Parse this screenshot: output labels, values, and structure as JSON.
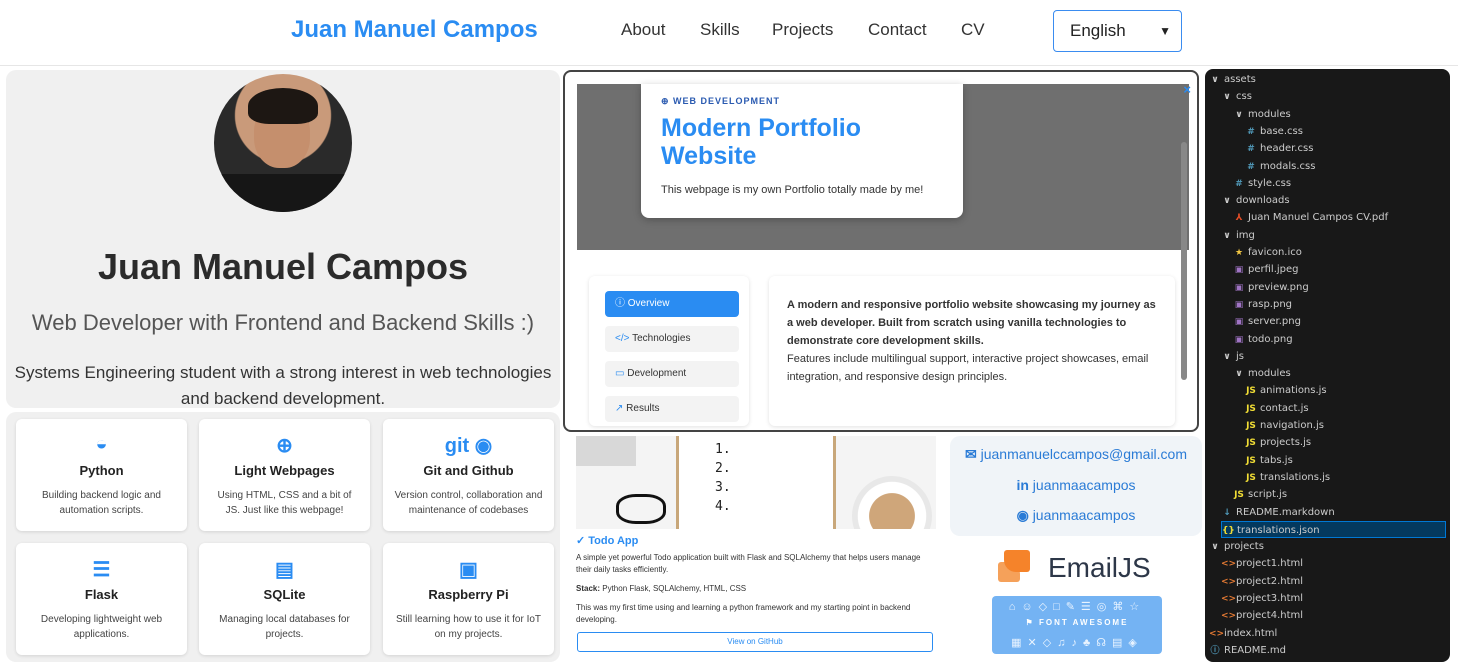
{
  "header": {
    "brand": "Juan Manuel Campos",
    "nav": [
      "About",
      "Skills",
      "Projects",
      "Contact",
      "CV"
    ],
    "language": "English"
  },
  "hero": {
    "name": "Juan Manuel Campos",
    "role": "Web Developer with Frontend and Backend Skills :)",
    "bio": "Systems Engineering student with a strong interest in web technologies and backend development."
  },
  "skills": [
    {
      "icon": "python-icon",
      "title": "Python",
      "desc": "Building backend logic and automation scripts."
    },
    {
      "icon": "globe-icon",
      "title": "Light Webpages",
      "desc": "Using HTML, CSS and a bit of JS. Just like this webpage!"
    },
    {
      "icon": "git-github-icon",
      "title": "Git and Github",
      "desc": "Version control, collaboration and maintenance of codebases"
    },
    {
      "icon": "server-icon",
      "title": "Flask",
      "desc": "Developing lightweight web applications."
    },
    {
      "icon": "database-icon",
      "title": "SQLite",
      "desc": "Managing local databases for projects."
    },
    {
      "icon": "chip-icon",
      "title": "Raspberry Pi",
      "desc": "Still learning how to use it for IoT on my projects."
    }
  ],
  "skill_git_text": "git",
  "modal": {
    "kicker": "WEB DEVELOPMENT",
    "title": "Modern Portfolio Website",
    "subtitle": "This webpage is my own Portfolio totally made by me!",
    "close": "×",
    "tabs": [
      "Overview",
      "Technologies",
      "Development",
      "Results"
    ],
    "tab_icons": [
      "ⓘ",
      "</>",
      "▭",
      "↗"
    ],
    "body_bold": "A modern and responsive portfolio website showcasing my journey as a web developer. Built from scratch using vanilla technologies to demonstrate core development skills.",
    "body_text": "Features include multilingual support, interactive project showcases, email integration, and responsive design principles."
  },
  "todo": {
    "list": [
      "1.",
      "2.",
      "3.",
      "4."
    ],
    "title": "Todo App",
    "desc": "A simple yet powerful Todo application built with Flask and SQLAlchemy that helps users manage their daily tasks efficiently.",
    "stack_label": "Stack:",
    "stack": "Python Flask, SQLAlchemy, HTML, CSS",
    "note": "This was my first time using and learning a python framework and my starting point in backend developing.",
    "button": "View on GitHub"
  },
  "contact": {
    "email": "juanmanuelccampos@gmail.com",
    "linkedin": "juanmaacampos",
    "github": "juanmaacampos"
  },
  "emailjs": "EmailJS",
  "fontawesome": "FONT AWESOME",
  "explorer": [
    {
      "label": "assets",
      "indent": 0,
      "type": "folder"
    },
    {
      "label": "css",
      "indent": 1,
      "type": "folder"
    },
    {
      "label": "modules",
      "indent": 2,
      "type": "folder"
    },
    {
      "label": "base.css",
      "indent": 3,
      "type": "css"
    },
    {
      "label": "header.css",
      "indent": 3,
      "type": "css"
    },
    {
      "label": "modals.css",
      "indent": 3,
      "type": "css"
    },
    {
      "label": "style.css",
      "indent": 2,
      "type": "css"
    },
    {
      "label": "downloads",
      "indent": 1,
      "type": "folder"
    },
    {
      "label": "Juan Manuel Campos CV.pdf",
      "indent": 2,
      "type": "pdf"
    },
    {
      "label": "img",
      "indent": 1,
      "type": "folder"
    },
    {
      "label": "favicon.ico",
      "indent": 2,
      "type": "star"
    },
    {
      "label": "perfil.jpeg",
      "indent": 2,
      "type": "img"
    },
    {
      "label": "preview.png",
      "indent": 2,
      "type": "img"
    },
    {
      "label": "rasp.png",
      "indent": 2,
      "type": "img"
    },
    {
      "label": "server.png",
      "indent": 2,
      "type": "img"
    },
    {
      "label": "todo.png",
      "indent": 2,
      "type": "img"
    },
    {
      "label": "js",
      "indent": 1,
      "type": "folder"
    },
    {
      "label": "modules",
      "indent": 2,
      "type": "folder"
    },
    {
      "label": "animations.js",
      "indent": 3,
      "type": "js"
    },
    {
      "label": "contact.js",
      "indent": 3,
      "type": "js"
    },
    {
      "label": "navigation.js",
      "indent": 3,
      "type": "js"
    },
    {
      "label": "projects.js",
      "indent": 3,
      "type": "js"
    },
    {
      "label": "tabs.js",
      "indent": 3,
      "type": "js"
    },
    {
      "label": "translations.js",
      "indent": 3,
      "type": "js"
    },
    {
      "label": "script.js",
      "indent": 2,
      "type": "js"
    },
    {
      "label": "README.markdown",
      "indent": 1,
      "type": "md"
    },
    {
      "label": "translations.json",
      "indent": 1,
      "type": "json",
      "selected": true
    },
    {
      "label": "projects",
      "indent": 0,
      "type": "folder"
    },
    {
      "label": "project1.html",
      "indent": 1,
      "type": "html"
    },
    {
      "label": "project2.html",
      "indent": 1,
      "type": "html"
    },
    {
      "label": "project3.html",
      "indent": 1,
      "type": "html"
    },
    {
      "label": "project4.html",
      "indent": 1,
      "type": "html"
    },
    {
      "label": "index.html",
      "indent": 0,
      "type": "html"
    },
    {
      "label": "README.md",
      "indent": 0,
      "type": "info"
    }
  ],
  "explorer_icons": {
    "folder": "∨",
    "css": "#",
    "pdf": "⅄",
    "star": "★",
    "img": "▣",
    "js": "JS",
    "md": "↓",
    "json": "{}",
    "html": "<>",
    "info": "ⓘ"
  },
  "explorer_colors": {
    "folder": "#cccccc",
    "css": "#519aba",
    "pdf": "#e44d26",
    "star": "#f2c744",
    "img": "#a074c4",
    "js": "#f1dd35",
    "md": "#519aba",
    "json": "#f1dd35",
    "html": "#e37933",
    "info": "#519aba"
  }
}
